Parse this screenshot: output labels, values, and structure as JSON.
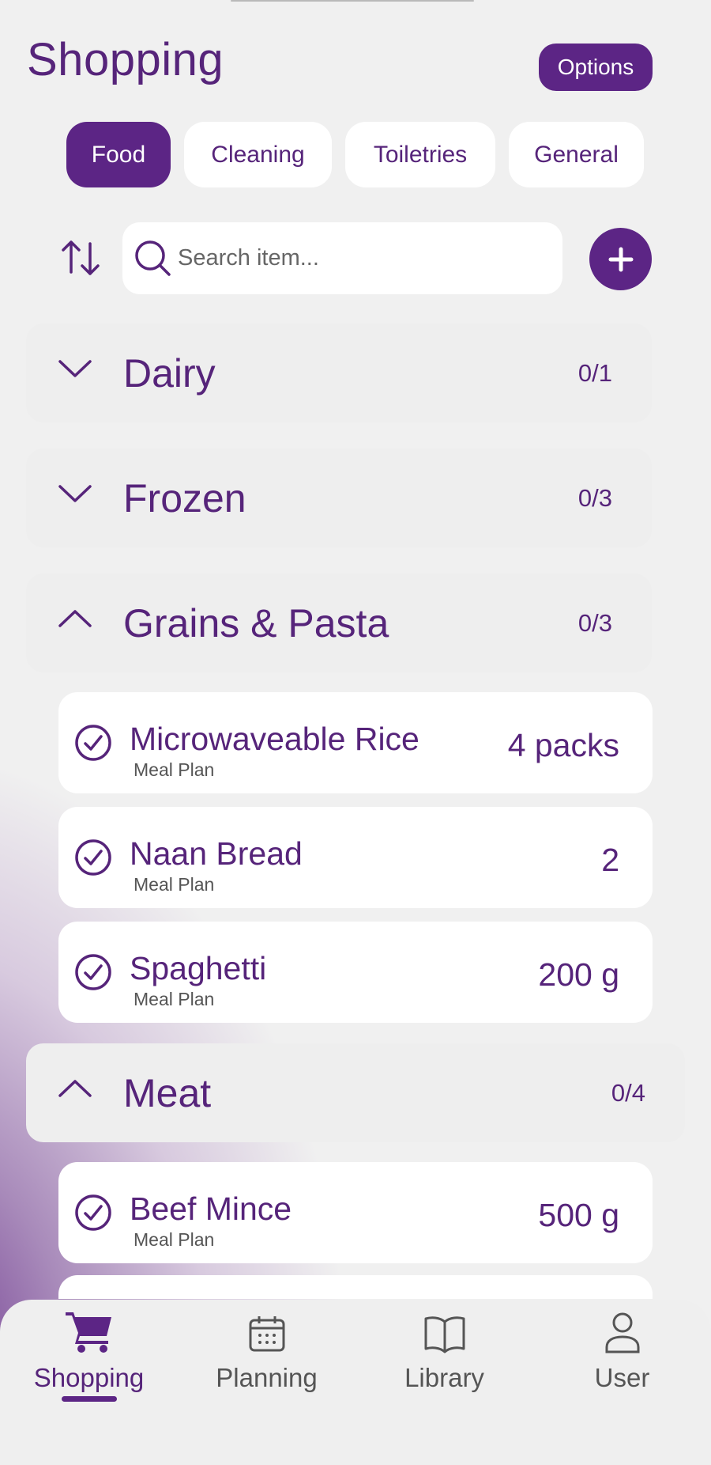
{
  "header": {
    "title": "Shopping",
    "options_label": "Options"
  },
  "tabs": [
    {
      "label": "Food",
      "active": true
    },
    {
      "label": "Cleaning",
      "active": false
    },
    {
      "label": "Toiletries",
      "active": false
    },
    {
      "label": "General",
      "active": false
    }
  ],
  "search": {
    "placeholder": "Search item...",
    "value": ""
  },
  "categories": [
    {
      "name": "Dairy",
      "count": "0/1",
      "expanded": false
    },
    {
      "name": "Frozen",
      "count": "0/3",
      "expanded": false
    },
    {
      "name": "Grains & Pasta",
      "count": "0/3",
      "expanded": true,
      "items": [
        {
          "name": "Microwaveable Rice",
          "source": "Meal Plan",
          "quantity": "4 packs"
        },
        {
          "name": "Naan Bread",
          "source": "Meal Plan",
          "quantity": "2"
        },
        {
          "name": "Spaghetti",
          "source": "Meal Plan",
          "quantity": "200 g"
        }
      ]
    },
    {
      "name": "Meat",
      "count": "0/4",
      "expanded": true,
      "items": [
        {
          "name": "Beef Mince",
          "source": "Meal Plan",
          "quantity": "500 g"
        }
      ]
    }
  ],
  "bottom_nav": [
    {
      "label": "Shopping",
      "icon": "cart-icon",
      "active": true
    },
    {
      "label": "Planning",
      "icon": "calendar-icon",
      "active": false
    },
    {
      "label": "Library",
      "icon": "book-icon",
      "active": false
    },
    {
      "label": "User",
      "icon": "user-icon",
      "active": false
    }
  ],
  "colors": {
    "accent": "#5c2585",
    "text_primary": "#56247a",
    "background": "#f0f0f0",
    "card": "#ffffff"
  }
}
